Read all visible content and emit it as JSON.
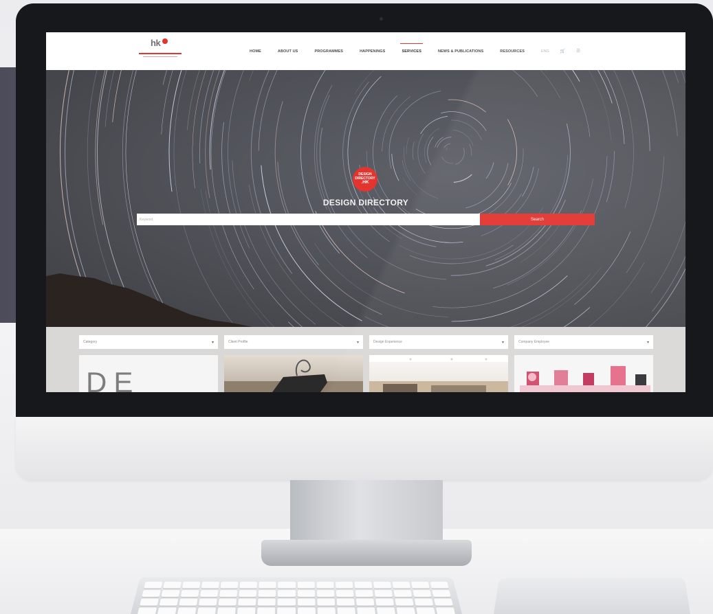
{
  "site": {
    "logo_text": "hk",
    "nav": [
      {
        "label": "HOME"
      },
      {
        "label": "ABOUT US"
      },
      {
        "label": "PROGRAMMES"
      },
      {
        "label": "HAPPENINGS"
      },
      {
        "label": "SERVICES",
        "active": true
      },
      {
        "label": "NEWS & PUBLICATIONS"
      },
      {
        "label": "RESOURCES"
      }
    ],
    "lang_label": "ENG",
    "cart_icon": "cart-icon",
    "menu_icon": "menu-icon"
  },
  "hero": {
    "badge_lines": [
      "DESIGN",
      "DIRECTORY",
      ".HK"
    ],
    "title": "DESIGN DIRECTORY",
    "search_placeholder": "Keyword",
    "search_button": "Search"
  },
  "filters": [
    {
      "label": "Category"
    },
    {
      "label": "Client Profile"
    },
    {
      "label": "Design Experience"
    },
    {
      "label": "Company Employee"
    }
  ],
  "cards": [
    {
      "text": "DE MORE"
    }
  ],
  "colors": {
    "accent": "#e3342f",
    "hero_bg": "#54565d",
    "filter_bg": "#d9d8d7"
  }
}
